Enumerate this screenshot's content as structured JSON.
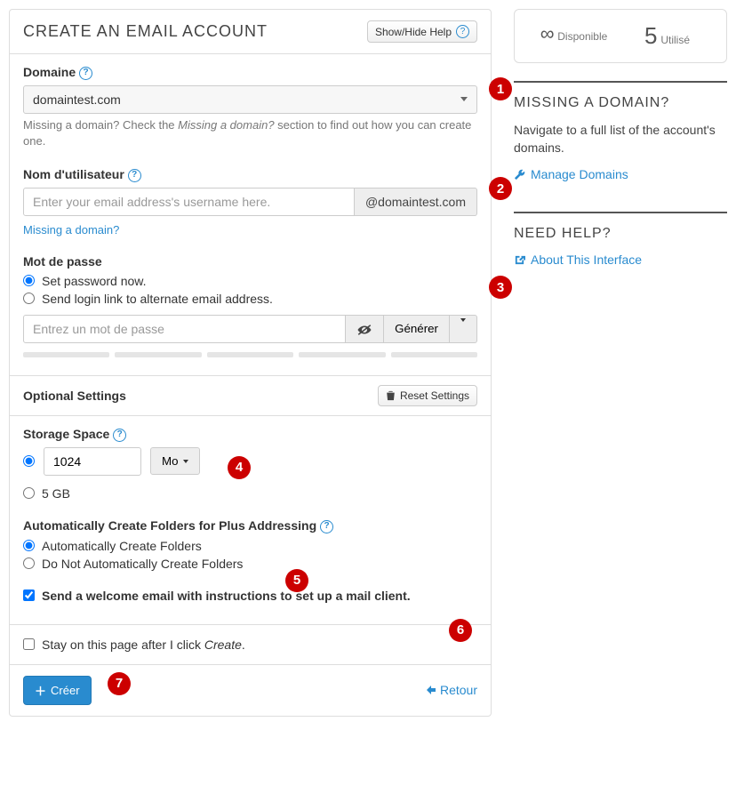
{
  "main_title": "CREATE AN EMAIL ACCOUNT",
  "toggle_help": "Show/Hide Help",
  "domain": {
    "label": "Domaine",
    "selected": "domaintest.com",
    "help_pre": "Missing a domain? Check the ",
    "help_em": "Missing a domain?",
    "help_post": " section to find out how you can create one."
  },
  "username": {
    "label": "Nom d'utilisateur",
    "placeholder": "Enter your email address's username here.",
    "addon": "@domaintest.com",
    "missing_link": "Missing a domain?"
  },
  "password": {
    "label": "Mot de passe",
    "opt_now": "Set password now.",
    "opt_link": "Send login link to alternate email address.",
    "placeholder": "Entrez un mot de passe",
    "generate": "Générer"
  },
  "optional": {
    "title": "Optional Settings",
    "reset": "Reset Settings",
    "storage_label": "Storage Space",
    "storage_value": "1024",
    "storage_unit": "Mo",
    "storage_alt": "5 GB",
    "plus_label": "Automatically Create Folders for Plus Addressing",
    "plus_yes": "Automatically Create Folders",
    "plus_no": "Do Not Automatically Create Folders",
    "welcome": "Send a welcome email with instructions to set up a mail client."
  },
  "stay_pre": "Stay on this page after I click ",
  "stay_em": "Create",
  "stay_post": ".",
  "create_btn": "Créer",
  "back_btn": "Retour",
  "stats": {
    "avail_label": "Disponible",
    "used_num": "5",
    "used_label": "Utilisé"
  },
  "side_missing": {
    "title": "MISSING A DOMAIN?",
    "text": "Navigate to a full list of the account's domains.",
    "link": "Manage Domains"
  },
  "side_help": {
    "title": "NEED HELP?",
    "link": "About This Interface"
  },
  "annotations": [
    "1",
    "2",
    "3",
    "4",
    "5",
    "6",
    "7"
  ]
}
